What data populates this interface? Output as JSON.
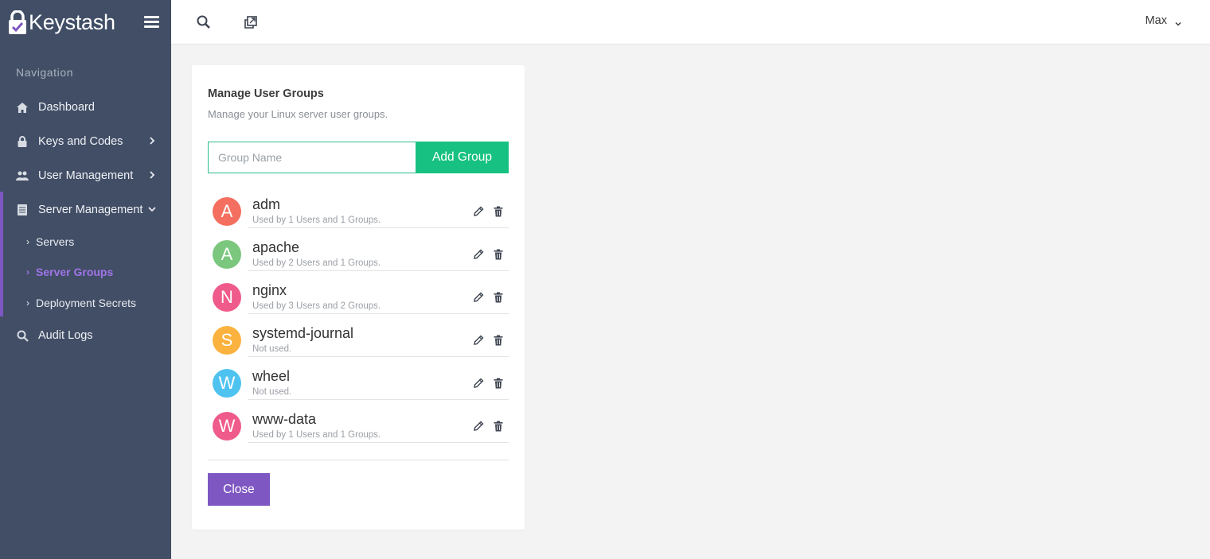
{
  "brand": {
    "name": "Keystash"
  },
  "topbar": {
    "user": "Max"
  },
  "nav": {
    "heading": "Navigation",
    "items": [
      {
        "label": "Dashboard",
        "icon": "home-icon"
      },
      {
        "label": "Keys and Codes",
        "icon": "lock-icon"
      },
      {
        "label": "User Management",
        "icon": "users-icon"
      },
      {
        "label": "Server Management",
        "icon": "server-icon"
      },
      {
        "label": "Audit Logs",
        "icon": "search-log-icon"
      }
    ],
    "sub_items": [
      {
        "label": "Servers"
      },
      {
        "label": "Server Groups",
        "active": true
      },
      {
        "label": "Deployment Secrets"
      }
    ]
  },
  "card": {
    "title": "Manage User Groups",
    "subtitle": "Manage your Linux server user groups.",
    "input_placeholder": "Group Name",
    "add_label": "Add Group",
    "close_label": "Close",
    "groups": [
      {
        "initial": "A",
        "name": "adm",
        "usage": "Used by 1 Users and 1 Groups.",
        "color": "#f46f5f"
      },
      {
        "initial": "A",
        "name": "apache",
        "usage": "Used by 2 Users and 1 Groups.",
        "color": "#7ac77d"
      },
      {
        "initial": "N",
        "name": "nginx",
        "usage": "Used by 3 Users and 2 Groups.",
        "color": "#ef5b8a"
      },
      {
        "initial": "S",
        "name": "systemd-journal",
        "usage": "Not used.",
        "color": "#fbb23e"
      },
      {
        "initial": "W",
        "name": "wheel",
        "usage": "Not used.",
        "color": "#4fc3f0"
      },
      {
        "initial": "W",
        "name": "www-data",
        "usage": "Used by 1 Users and 1 Groups.",
        "color": "#ef5b8a"
      }
    ]
  },
  "colors": {
    "sidebar": "#414e66",
    "accent": "#7e57c2",
    "success": "#17c181"
  }
}
